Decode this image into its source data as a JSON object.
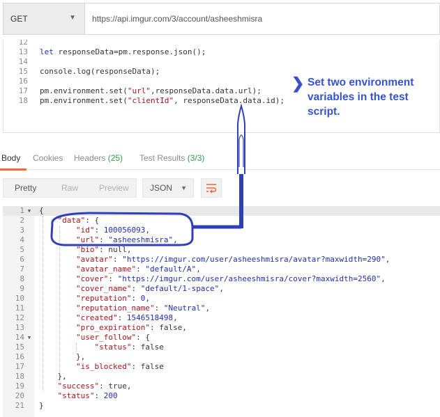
{
  "request": {
    "method": "GET",
    "url": "https://api.imgur.com/3/account/asheeshmisra"
  },
  "script_lines": [
    {
      "num": "12",
      "code": ""
    },
    {
      "num": "13",
      "code": "let responseData=pm.response.json();"
    },
    {
      "num": "14",
      "code": ""
    },
    {
      "num": "15",
      "code": "console.log(responseData);"
    },
    {
      "num": "16",
      "code": ""
    },
    {
      "num": "17",
      "code": "pm.environment.set(\"url\",responseData.data.url);"
    },
    {
      "num": "18",
      "code": "pm.environment.set(\"clientId\", responseData.data.id);"
    }
  ],
  "annotation": {
    "chevron": "❯",
    "text": "Set two environment variables in the test script."
  },
  "tabs": {
    "body": "Body",
    "cookies": "Cookies",
    "headers": "Headers",
    "headers_count": "(25)",
    "test_results": "Test Results",
    "test_results_count": "(3/3)"
  },
  "toolbar": {
    "pretty": "Pretty",
    "raw": "Raw",
    "preview": "Preview",
    "format": "JSON",
    "wrap_icon": "wrap-lines-icon"
  },
  "response_lines": [
    {
      "num": "1",
      "fold": true,
      "code": "{"
    },
    {
      "num": "2",
      "fold": false,
      "code": "    \"data\": {"
    },
    {
      "num": "3",
      "fold": false,
      "code": "        \"id\": 100056093,"
    },
    {
      "num": "4",
      "fold": false,
      "code": "        \"url\": \"asheeshmisra\","
    },
    {
      "num": "5",
      "fold": false,
      "code": "        \"bio\": null,"
    },
    {
      "num": "6",
      "fold": false,
      "code": "        \"avatar\": \"https://imgur.com/user/asheeshmisra/avatar?maxwidth=290\","
    },
    {
      "num": "7",
      "fold": false,
      "code": "        \"avatar_name\": \"default/A\","
    },
    {
      "num": "8",
      "fold": false,
      "code": "        \"cover\": \"https://imgur.com/user/asheeshmisra/cover?maxwidth=2560\","
    },
    {
      "num": "9",
      "fold": false,
      "code": "        \"cover_name\": \"default/1-space\","
    },
    {
      "num": "10",
      "fold": false,
      "code": "        \"reputation\": 0,"
    },
    {
      "num": "11",
      "fold": false,
      "code": "        \"reputation_name\": \"Neutral\","
    },
    {
      "num": "12",
      "fold": false,
      "code": "        \"created\": 1546518498,"
    },
    {
      "num": "13",
      "fold": false,
      "code": "        \"pro_expiration\": false,"
    },
    {
      "num": "14",
      "fold": true,
      "code": "        \"user_follow\": {"
    },
    {
      "num": "15",
      "fold": false,
      "code": "            \"status\": false"
    },
    {
      "num": "16",
      "fold": false,
      "code": "        },"
    },
    {
      "num": "17",
      "fold": false,
      "code": "        \"is_blocked\": false"
    },
    {
      "num": "18",
      "fold": false,
      "code": "    },"
    },
    {
      "num": "19",
      "fold": false,
      "code": "    \"success\": true,"
    },
    {
      "num": "20",
      "fold": false,
      "code": "    \"status\": 200"
    },
    {
      "num": "21",
      "fold": false,
      "code": "}"
    }
  ],
  "colors": {
    "accent": "#f26b3a",
    "annotation": "#3553cf",
    "success": "#2e9e44"
  }
}
